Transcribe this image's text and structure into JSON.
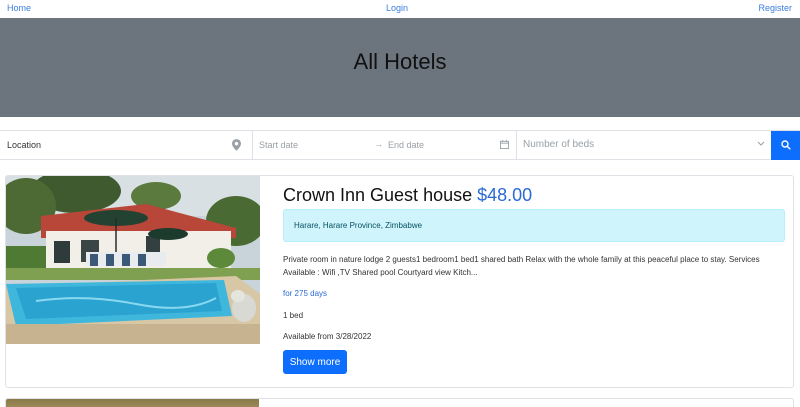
{
  "nav": {
    "home": "Home",
    "login": "Login",
    "register": "Register"
  },
  "hero": {
    "title": "All Hotels"
  },
  "search": {
    "location_placeholder": "Location",
    "start_date_placeholder": "Start date",
    "arrow": "→",
    "end_date_placeholder": "End date",
    "beds_placeholder": "Number of beds",
    "icons": [
      "map-pin-icon",
      "calendar-icon",
      "chevron-down-icon",
      "search-icon"
    ],
    "button_color": "#0d6efd"
  },
  "listings": [
    {
      "name": "Crown Inn Guest house",
      "price": "$48.00",
      "location": "Harare, Harare Province, Zimbabwe",
      "description": "Private room in nature lodge 2 guests1 bedroom1 bed1 shared bath Relax with the whole family at this peaceful place to stay. Services Available : Wifi ,TV Shared pool Courtyard view Kitch...",
      "duration": "for 275 days",
      "beds": "1 bed",
      "available": "Available from 3/28/2022",
      "button": "Show more"
    }
  ],
  "colors": {
    "hero_bg": "#6c757d",
    "accent": "#0d6efd",
    "link": "#3b7ddd",
    "alert_bg": "#cff4fc"
  }
}
